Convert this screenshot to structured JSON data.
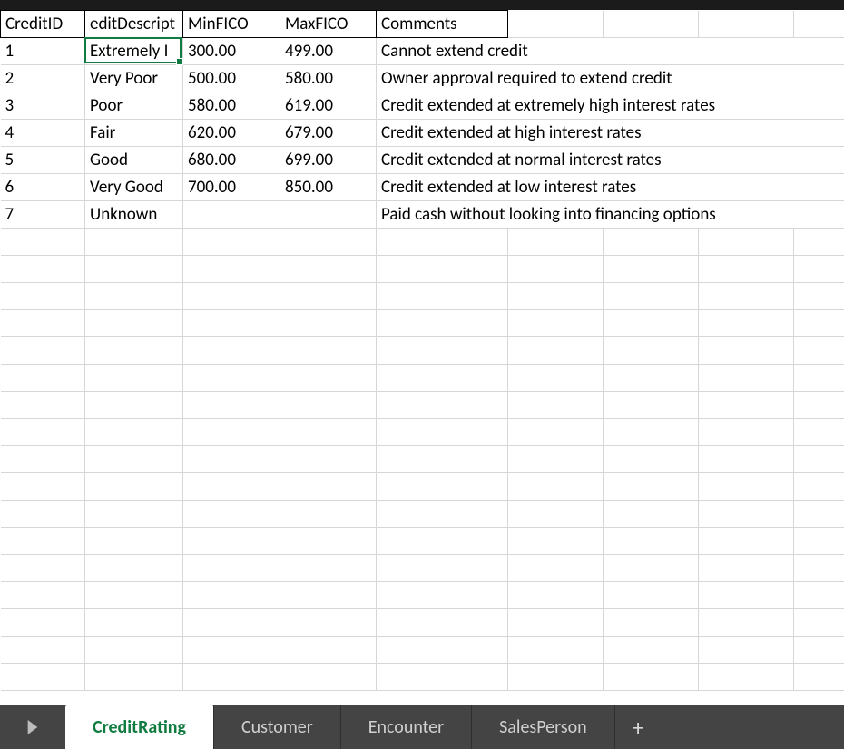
{
  "headers": {
    "A": "CreditID",
    "B": "editDescript",
    "C": "MinFICO",
    "D": "MaxFICO",
    "E": "Comments"
  },
  "selectedCellFull": "Extremely Poor",
  "rows": [
    {
      "id": "1",
      "desc": "Extremely I",
      "min": "300.00",
      "max": "499.00",
      "comment": "Cannot extend credit"
    },
    {
      "id": "2",
      "desc": "Very Poor",
      "min": "500.00",
      "max": "580.00",
      "comment": "Owner approval required to extend credit"
    },
    {
      "id": "3",
      "desc": "Poor",
      "min": "580.00",
      "max": "619.00",
      "comment": "Credit extended at extremely high interest rates"
    },
    {
      "id": "4",
      "desc": "Fair",
      "min": "620.00",
      "max": "679.00",
      "comment": "Credit extended at high interest rates"
    },
    {
      "id": "5",
      "desc": "Good",
      "min": "680.00",
      "max": "699.00",
      "comment": "Credit extended at normal interest rates"
    },
    {
      "id": "6",
      "desc": "Very Good",
      "min": "700.00",
      "max": "850.00",
      "comment": "Credit extended at low interest rates"
    },
    {
      "id": "7",
      "desc": "Unknown",
      "min": "",
      "max": "",
      "comment": "Paid cash without looking into financing options"
    }
  ],
  "tabs": {
    "active": "CreditRating",
    "others": [
      "Customer",
      "Encounter",
      "SalesPerson"
    ]
  },
  "icons": {
    "add": "+"
  }
}
